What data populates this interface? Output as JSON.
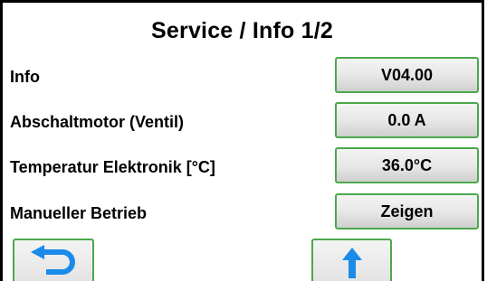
{
  "header": {
    "title": "Service / Info 1/2"
  },
  "rows": [
    {
      "label": "Info",
      "value": "V04.00"
    },
    {
      "label": "Abschaltmotor (Ventil)",
      "value": "0.0 A"
    },
    {
      "label": "Temperatur Elektronik [°C]",
      "value": "36.0°C"
    },
    {
      "label": "Manueller Betrieb",
      "value": "Zeigen"
    }
  ],
  "nav": {
    "back_icon": "back-arrow-icon",
    "up_icon": "up-arrow-icon"
  },
  "colors": {
    "button_border": "#4ca84c",
    "icon": "#1a8be8"
  }
}
